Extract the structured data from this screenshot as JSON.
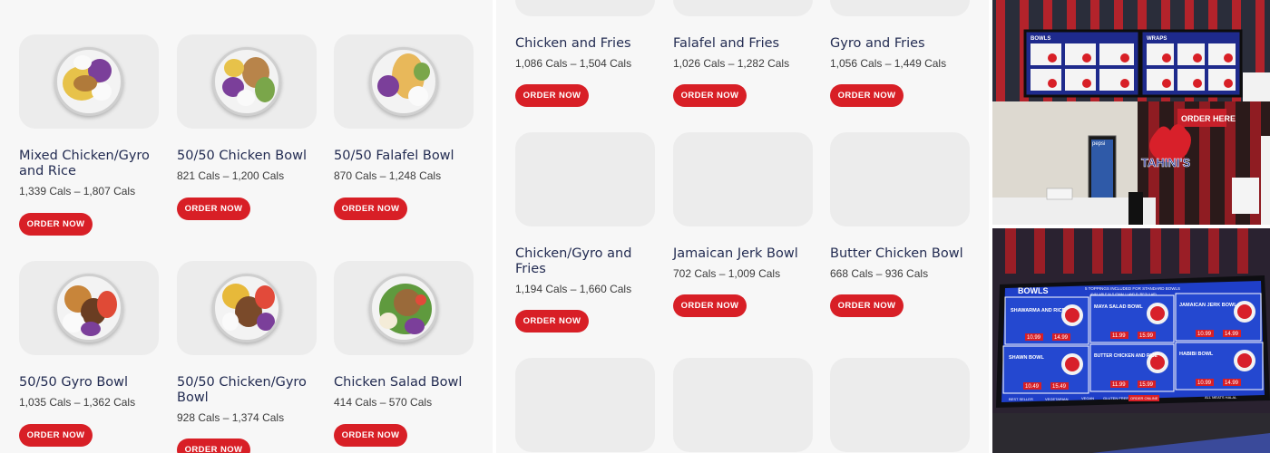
{
  "order_label": "ORDER NOW",
  "left_items": [
    {
      "title": "Mixed Chicken/Gyro and Rice",
      "cals": "1,339 Cals – 1,807 Cals"
    },
    {
      "title": "50/50 Chicken Bowl",
      "cals": "821 Cals – 1,200 Cals"
    },
    {
      "title": "50/50 Falafel Bowl",
      "cals": "870 Cals – 1,248 Cals"
    },
    {
      "title": "50/50 Gyro Bowl",
      "cals": "1,035 Cals – 1,362 Cals"
    },
    {
      "title": "50/50 Chicken/Gyro Bowl",
      "cals": "928 Cals – 1,374 Cals"
    },
    {
      "title": "Chicken Salad Bowl",
      "cals": "414 Cals – 570 Cals"
    }
  ],
  "mid_items": [
    {
      "title": "Chicken and Fries",
      "cals": "1,086 Cals – 1,504 Cals"
    },
    {
      "title": "Falafel and Fries",
      "cals": "1,026 Cals – 1,282 Cals"
    },
    {
      "title": "Gyro and Fries",
      "cals": "1,056 Cals – 1,449 Cals"
    },
    {
      "title": "Chicken/Gyro and Fries",
      "cals": "1,194 Cals – 1,660 Cals"
    },
    {
      "title": "Jamaican Jerk Bowl",
      "cals": "702 Cals – 1,009 Cals"
    },
    {
      "title": "Butter Chicken Bowl",
      "cals": "668 Cals – 936 Cals"
    }
  ],
  "photo_top": {
    "board_left_label": "BOWLS",
    "board_right_label": "WRAPS",
    "order_sign": "ORDER HERE",
    "logo_text": "TAHINI'S",
    "fridge_label": "pepsi",
    "pos_brand": "Tahini's"
  },
  "photo_bottom": {
    "banner": "5 TOPPINGS INCLUDED FOR STANDARD BOWLS",
    "banner_sub": "AVAILABLE IN S (SMALL) AND R (REGULAR)",
    "header": "BOWLS",
    "cells": [
      {
        "name": "SHAWARMA AND RICE",
        "s": "10.99",
        "r": "14.99"
      },
      {
        "name": "MAYA SALAD BOWL",
        "s": "11.99",
        "r": "15.99"
      },
      {
        "name": "JAMAICAN JERK BOWL",
        "s": "10.99",
        "r": "14.99"
      },
      {
        "name": "SHAWN BOWL",
        "s": "10.49",
        "r": "15.49"
      },
      {
        "name": "BUTTER CHICKEN AND RICE",
        "s": "11.99",
        "r": "15.99"
      },
      {
        "name": "HABIBI BOWL",
        "s": "10.99",
        "r": "14.99"
      }
    ],
    "footer": [
      "BEST SELLER",
      "VEGETARIAN",
      "VEGAN",
      "GLUTEN FREE",
      "ORDER ONLINE",
      "ALL MEATS HALAL"
    ]
  }
}
